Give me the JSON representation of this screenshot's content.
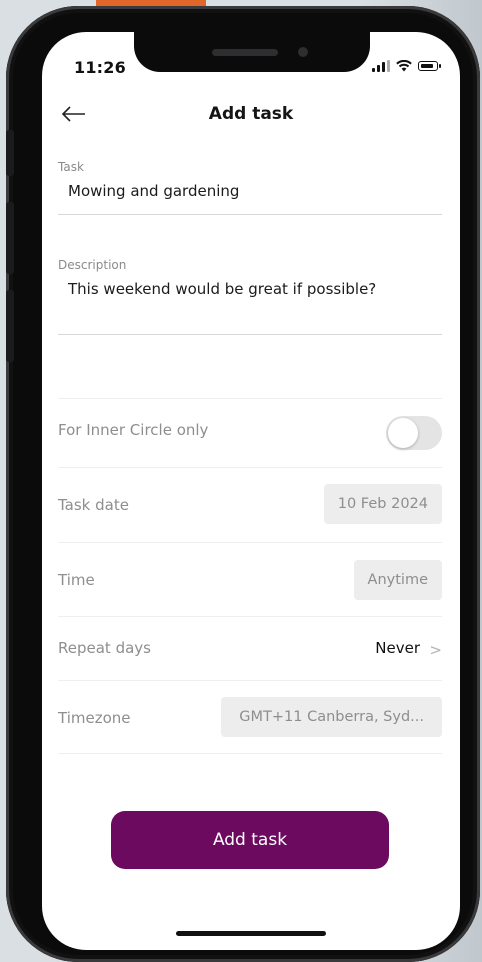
{
  "status": {
    "time": "11:26"
  },
  "header": {
    "title": "Add task"
  },
  "task": {
    "label": "Task",
    "value": "Mowing and gardening"
  },
  "description": {
    "label": "Description",
    "value": "This weekend would be great if possible?"
  },
  "inner_circle": {
    "label": "For Inner Circle only",
    "enabled": false
  },
  "task_date": {
    "label": "Task date",
    "value": "10 Feb 2024"
  },
  "time": {
    "label": "Time",
    "value": "Anytime"
  },
  "repeat": {
    "label": "Repeat days",
    "value": "Never"
  },
  "timezone": {
    "label": "Timezone",
    "value": "GMT+11 Canberra, Syd..."
  },
  "actions": {
    "submit_label": "Add task"
  },
  "colors": {
    "primary": "#6c0a5f",
    "toggle_off": "#e4e4e4",
    "pill_bg": "#ededed"
  }
}
